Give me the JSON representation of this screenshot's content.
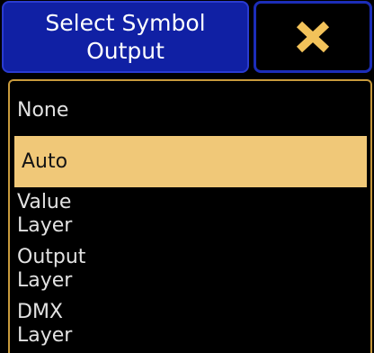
{
  "dialog": {
    "title_line1": "Select Symbol",
    "title_line2": "Output",
    "close_icon_color": "#f2c25a",
    "accent_color": "#1020a4",
    "selected_color": "#f0c878"
  },
  "options": {
    "none": "None",
    "auto": "Auto",
    "value_layer": [
      "Value",
      "Layer"
    ],
    "output_layer": [
      "Output",
      "Layer"
    ],
    "dmx_layer": [
      "DMX",
      "Layer"
    ],
    "selected": "Auto"
  }
}
